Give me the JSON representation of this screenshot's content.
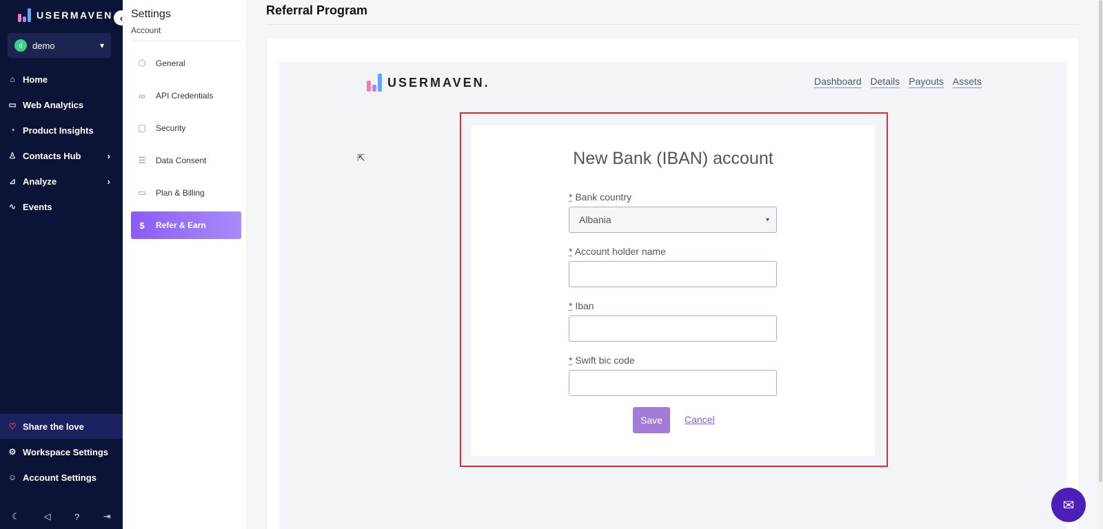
{
  "brand": {
    "name": "USERMAVEN.",
    "colors": {
      "nav_bg": "#0b1437",
      "accent": "#8b5cf6",
      "highlight": "#e3282e"
    }
  },
  "workspace": {
    "initial": "d",
    "name": "demo"
  },
  "nav": {
    "collapse_icon": "chevron-left-icon",
    "items": [
      {
        "label": "Home",
        "icon": "home-icon"
      },
      {
        "label": "Web Analytics",
        "icon": "browser-icon"
      },
      {
        "label": "Product Insights",
        "icon": "pie-chart-icon"
      },
      {
        "label": "Contacts Hub",
        "icon": "user-icon",
        "has_arrow": true
      },
      {
        "label": "Analyze",
        "icon": "chart-icon",
        "has_arrow": true
      },
      {
        "label": "Events",
        "icon": "pulse-icon"
      }
    ],
    "bottom_items": [
      {
        "label": "Share the love",
        "icon": "heart-icon"
      },
      {
        "label": "Workspace Settings",
        "icon": "gear-icon"
      },
      {
        "label": "Account Settings",
        "icon": "user-cog-icon"
      }
    ],
    "footer_icons": [
      "moon-icon",
      "megaphone-icon",
      "help-icon",
      "logout-icon"
    ]
  },
  "settings": {
    "title": "Settings",
    "subtitle": "Account",
    "items": [
      {
        "label": "General",
        "icon": "hexagon-gear-icon"
      },
      {
        "label": "API Credentials",
        "icon": "link-icon"
      },
      {
        "label": "Security",
        "icon": "lock-icon"
      },
      {
        "label": "Data Consent",
        "icon": "database-icon"
      },
      {
        "label": "Plan & Billing",
        "icon": "credit-card-icon"
      },
      {
        "label": "Refer & Earn",
        "icon": "dollar-icon",
        "active": true
      }
    ]
  },
  "main": {
    "title": "Referral Program",
    "inner_nav": [
      "Dashboard",
      "Details",
      "Payouts",
      "Assets"
    ]
  },
  "form": {
    "title": "New Bank (IBAN) account",
    "required_mark": "*",
    "fields": [
      {
        "label": "Bank country",
        "value": "Albania",
        "type": "select"
      },
      {
        "label": "Account holder name",
        "value": ""
      },
      {
        "label": "Iban",
        "value": ""
      },
      {
        "label": "Swift bic code",
        "value": ""
      }
    ],
    "save_label": "Save",
    "cancel_label": "Cancel"
  }
}
